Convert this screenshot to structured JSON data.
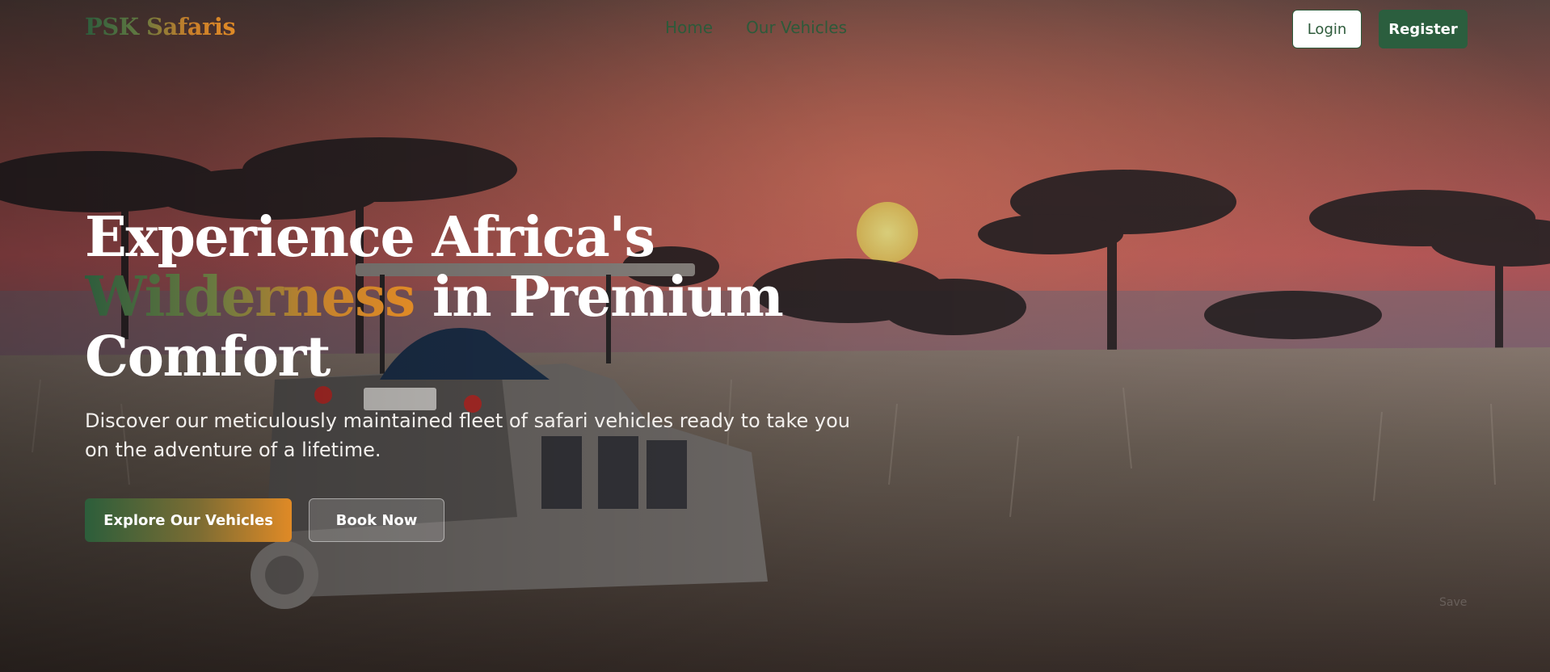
{
  "brand": "PSK Safaris",
  "nav": {
    "links": [
      "Home",
      "Our Vehicles"
    ]
  },
  "auth": {
    "login": "Login",
    "register": "Register"
  },
  "hero": {
    "title_line1": "Experience Africa's",
    "title_accent": "Wilderness",
    "title_rest": " in Premium",
    "title_line3": "Comfort",
    "subtitle": "Discover our meticulously maintained fleet of safari vehicles ready to take you on the adventure of a lifetime.",
    "primary_cta": "Explore Our Vehicles",
    "secondary_cta": "Book Now"
  },
  "faint_corner_text": "Save",
  "colors": {
    "brand_green": "#2b5e3e",
    "accent_orange": "#e08a26",
    "sky": "#b8575a",
    "grass": "#6e6258"
  }
}
